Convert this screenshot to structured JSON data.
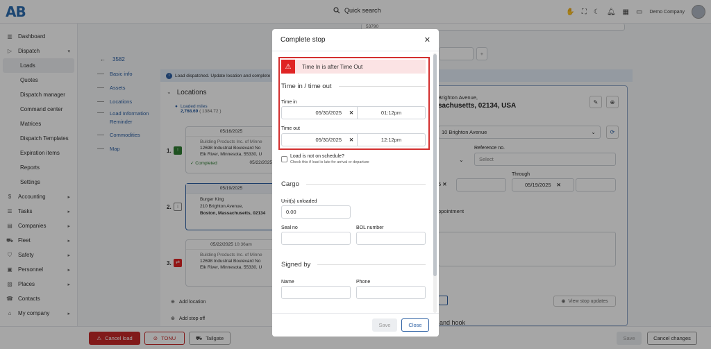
{
  "app": {
    "logo": "AB",
    "search_label": "Quick search",
    "company": "Demo Company"
  },
  "sidebar": {
    "items": [
      {
        "label": "Dashboard",
        "icon": "chart-icon",
        "level": 0
      },
      {
        "label": "Dispatch",
        "icon": "dispatch-icon",
        "level": 0,
        "chevron": "▾"
      },
      {
        "label": "Loads",
        "level": 1,
        "active": true
      },
      {
        "label": "Quotes",
        "level": 1
      },
      {
        "label": "Dispatch manager",
        "level": 1
      },
      {
        "label": "Command center",
        "level": 1
      },
      {
        "label": "Matrices",
        "level": 1
      },
      {
        "label": "Dispatch Templates",
        "level": 1
      },
      {
        "label": "Expiration items",
        "level": 1
      },
      {
        "label": "Reports",
        "level": 1
      },
      {
        "label": "Settings",
        "level": 1
      },
      {
        "label": "Accounting",
        "icon": "dollar-icon",
        "level": 0,
        "chevron": "▸"
      },
      {
        "label": "Tasks",
        "icon": "tasks-icon",
        "level": 0,
        "chevron": "▸"
      },
      {
        "label": "Companies",
        "icon": "building-icon",
        "level": 0,
        "chevron": "▸"
      },
      {
        "label": "Fleet",
        "icon": "truck-icon",
        "level": 0,
        "chevron": "▸"
      },
      {
        "label": "Safety",
        "icon": "shield-icon",
        "level": 0,
        "chevron": "▸"
      },
      {
        "label": "Personnel",
        "icon": "id-card-icon",
        "level": 0,
        "chevron": "▸"
      },
      {
        "label": "Places",
        "icon": "map-icon",
        "level": 0,
        "chevron": "▸"
      },
      {
        "label": "Contacts",
        "icon": "phone-icon",
        "level": 0
      },
      {
        "label": "My company",
        "icon": "home-icon",
        "level": 0,
        "chevron": "▸"
      }
    ]
  },
  "load": {
    "id": "3582",
    "top_ref": "53790"
  },
  "subnav": [
    "Basic info",
    "Assets",
    "Locations",
    "Load Information Reminder",
    "Commodities",
    "Map"
  ],
  "banner": "Load dispatched. Update location and complete",
  "locations": {
    "title": "Locations",
    "loaded_label": "Loaded miles",
    "loaded_value": "2,768.69",
    "loaded_sub": "( 1384.72 )"
  },
  "stops": [
    {
      "num": "1.",
      "date": "05/16/2025",
      "name": "Building Products Inc. of Minne",
      "addr1": "12698 Industrial Boulevard No",
      "addr2": "Elk River, Minnesota, 55330, U",
      "status": "✓ Completed",
      "date2": "05/22/2025"
    },
    {
      "num": "2.",
      "date": "05/19/2025",
      "name": "Burger King",
      "addr1": "210 Brighton Avenue,",
      "addr2": "Boston, Massachusetts, 02134"
    },
    {
      "num": "3.",
      "date": "05/22/2025",
      "time": "10:36am",
      "name": "Building Products Inc. of Minne",
      "addr1": "12698 Industrial Boulevard No",
      "addr2": "Elk River, Minnesota, 55330, U"
    }
  ],
  "left_actions": {
    "add_location": "Add location",
    "add_stop_off": "Add stop off"
  },
  "right": {
    "addr_line1": "Brighton Avenue,",
    "addr_line2": "sachusetts, 02134, USA",
    "select_value": "10 Brighton Avenue",
    "ref_label": "Reference no.",
    "ref_placeholder": "Select",
    "through_label": "Through",
    "through_value": "05/19/2025",
    "date_partial": "5",
    "appointment": "ppointment",
    "view_updates": "View stop updates",
    "and_hook": "and hook"
  },
  "bottom": {
    "cancel_load": "Cancel load",
    "tonu": "TONU",
    "tailgate": "Tailgate",
    "save": "Save",
    "cancel_changes": "Cancel changes"
  },
  "modal": {
    "title": "Complete stop",
    "alert": "Time In is after Time Out",
    "time_section": "Time in / time out",
    "time_in_label": "Time in",
    "time_in_date": "05/30/2025",
    "time_in_time": "01:12pm",
    "time_out_label": "Time out",
    "time_out_date": "05/30/2025",
    "time_out_time": "12:12pm",
    "schedule_label": "Load is not on schedule?",
    "schedule_hint": "Check this if load is late for arrival or departure",
    "cargo_section": "Cargo",
    "units_label": "Unit(s) unloaded",
    "units_value": "0.00",
    "seal_label": "Seal no",
    "bol_label": "BOL number",
    "signed_section": "Signed by",
    "name_label": "Name",
    "phone_label": "Phone",
    "save": "Save",
    "close": "Close"
  },
  "colors": {
    "accent": "#2b5fa3",
    "danger": "#e02424",
    "highlight_border": "#d32f2f",
    "success": "#2e7d32"
  }
}
